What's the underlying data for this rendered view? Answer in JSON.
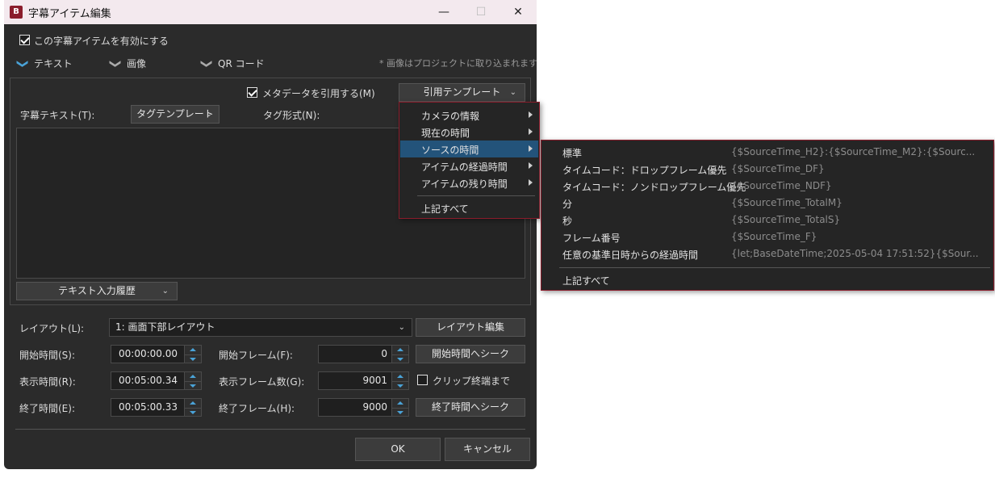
{
  "window": {
    "title": "字幕アイテム編集",
    "icon_text": "B",
    "min": "—",
    "max": "☐",
    "close": "✕"
  },
  "enable_item": {
    "label": "この字幕アイテムを有効にする",
    "checked": true
  },
  "tabs": [
    {
      "label": "テキスト",
      "active": true
    },
    {
      "label": "画像",
      "active": false
    },
    {
      "label": "QR コード",
      "active": false
    }
  ],
  "tab_note": "* 画像はプロジェクトに取り込まれます。",
  "text_panel": {
    "use_metadata_label": "メタデータを引用する(M)",
    "use_metadata_checked": true,
    "quote_template_btn": "引用テンプレート",
    "subtitle_text_label": "字幕テキスト(T):",
    "tag_template_btn": "タグテンプレート",
    "tag_format_label": "タグ形式(N):",
    "history_btn": "テキスト入力履歴"
  },
  "layout": {
    "label": "レイアウト(L):",
    "value": "1: 画面下部レイアウト",
    "edit_btn": "レイアウト編集"
  },
  "times": {
    "start_label": "開始時間(S):",
    "start_value": "00:00:00.00",
    "duration_label": "表示時間(R):",
    "duration_value": "00:05:00.34",
    "end_label": "終了時間(E):",
    "end_value": "00:05:00.33",
    "start_frame_label": "開始フレーム(F):",
    "start_frame_value": "0",
    "frame_count_label": "表示フレーム数(G):",
    "frame_count_value": "9001",
    "end_frame_label": "終了フレーム(H):",
    "end_frame_value": "9000",
    "seek_start_btn": "開始時間へシーク",
    "clip_end_label": "クリップ終端まで",
    "clip_end_checked": false,
    "seek_end_btn": "終了時間へシーク"
  },
  "footer": {
    "ok": "OK",
    "cancel": "キャンセル"
  },
  "menu1": {
    "items": [
      {
        "label": "カメラの情報",
        "submenu": true,
        "selected": false
      },
      {
        "label": "現在の時間",
        "submenu": true,
        "selected": false
      },
      {
        "label": "ソースの時間",
        "submenu": true,
        "selected": true
      },
      {
        "label": "アイテムの経過時間",
        "submenu": true,
        "selected": false
      },
      {
        "label": "アイテムの残り時間",
        "submenu": true,
        "selected": false
      }
    ],
    "all_label": "上記すべて"
  },
  "menu2": {
    "items": [
      {
        "label": "標準",
        "value": "{$SourceTime_H2}:{$SourceTime_M2}:{$Sourc..."
      },
      {
        "label": "タイムコード：ドロップフレーム優先",
        "value": "{$SourceTime_DF}"
      },
      {
        "label": "タイムコード：ノンドロップフレーム優先",
        "value": "{$SourceTime_NDF}"
      },
      {
        "label": "分",
        "value": "{$SourceTime_TotalM}"
      },
      {
        "label": "秒",
        "value": "{$SourceTime_TotalS}"
      },
      {
        "label": "フレーム番号",
        "value": "{$SourceTime_F}"
      },
      {
        "label": "任意の基準日時からの経過時間",
        "value": "{let;BaseDateTime;2025-05-04 17:51:52}{$Sour..."
      }
    ],
    "all_label": "上記すべて"
  },
  "colors": {
    "accent": "#4aa3d8",
    "menu_selected": "#23537a",
    "menu_border": "#8a1c2b"
  }
}
